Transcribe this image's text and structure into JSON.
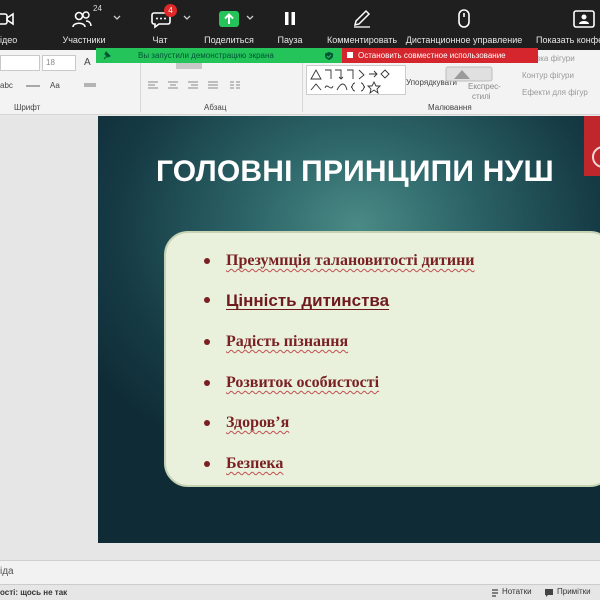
{
  "zoom_toolbar": {
    "video_label": "ідео",
    "participants_label": "Участники",
    "participants_count": "24",
    "chat_label": "Чат",
    "chat_badge": "4",
    "share_label": "Поделиться",
    "pause_label": "Пауза",
    "annotate_label": "Комментировать",
    "remote_label": "Дистанционное управление",
    "show_conf_label": "Показать конфе"
  },
  "share_banner": {
    "message": "Вы запустили демонстрацию экрана",
    "stop_label": "Остановить совместное использование"
  },
  "ribbon": {
    "font_size_value": "18",
    "font_group_label": "Шрифт",
    "paragraph_group_label": "Абзац",
    "drawing_group_label": "Малювання",
    "arrange_label": "Упорядкувати",
    "quick_styles_label_1": "Експрес-",
    "quick_styles_label_2": "стилі",
    "shape_fill_label": "вка фігури",
    "shape_outline_label": "Контур фігури",
    "shape_effects_label": "Ефекти для фігур",
    "abc_label": "abc",
    "aa_label": "Aa",
    "text_a_label": "A"
  },
  "slide": {
    "title": "ГОЛОВНІ ПРИНЦИПИ НУШ",
    "bullets": [
      "Презумпція талановитості дитини",
      "Цінність дитинства",
      "Радість пізнання",
      "Розвиток особистості",
      "Здоров’я",
      "Безпека"
    ]
  },
  "notes": {
    "placeholder": "іда"
  },
  "statusbar": {
    "accessibility": "ості: щось не так",
    "notes_label": "Нотатки",
    "comments_label": "Примітки"
  },
  "colors": {
    "zoom_bg": "#1f1f1f",
    "share_green": "#24c45a",
    "stop_red": "#d6262d",
    "bullet_color": "#7a1f22",
    "bullet_box_bg": "#e9f1dc"
  }
}
